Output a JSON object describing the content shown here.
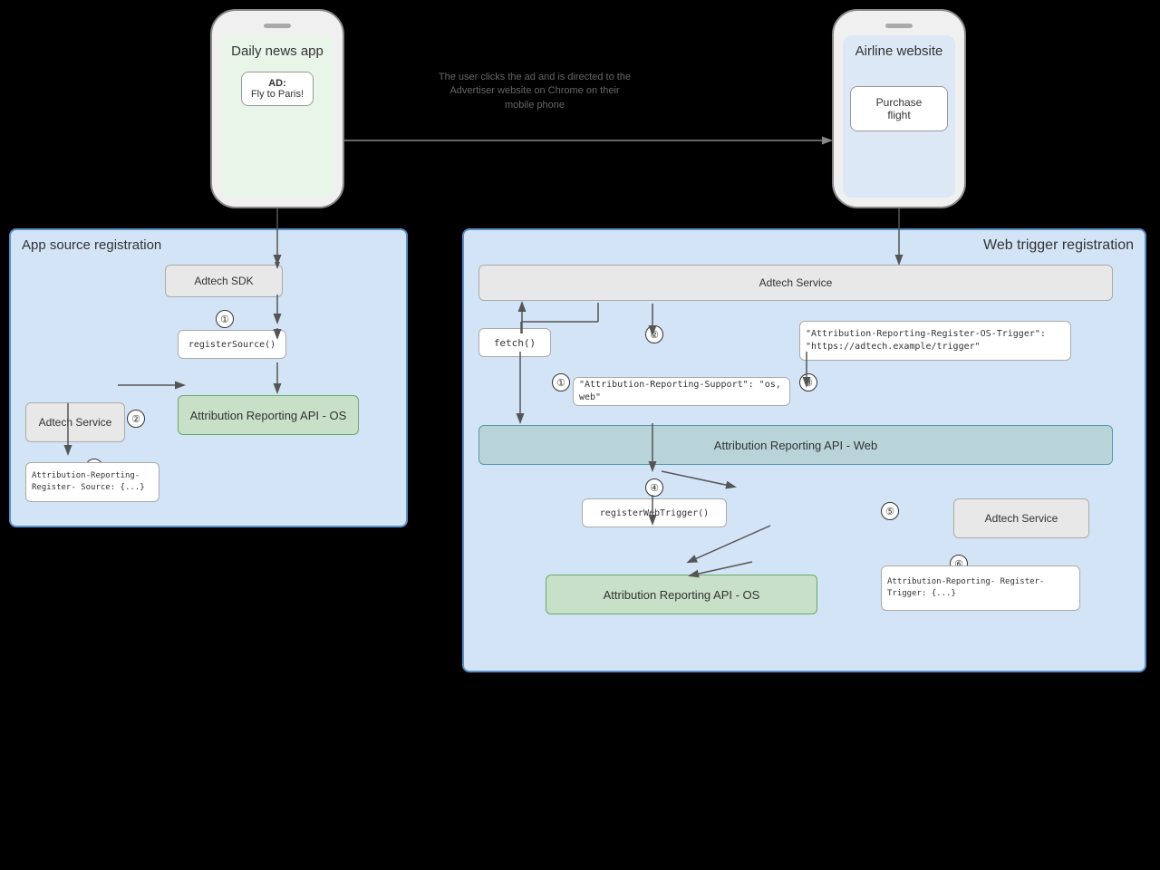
{
  "phones": {
    "left": {
      "title": "Daily news app",
      "ad_label": "AD:",
      "ad_text": "Fly to Paris!"
    },
    "right": {
      "title": "Airline website",
      "button_text": "Purchase flight"
    }
  },
  "arrow_description": "The user clicks the ad and is directed to\nthe Advertiser website on Chrome on\ntheir mobile phone",
  "panels": {
    "left": {
      "label": "App source registration"
    },
    "right": {
      "label": "Web trigger registration"
    }
  },
  "left_panel": {
    "adtech_sdk": "Adtech SDK",
    "adtech_service": "Adtech Service",
    "register_source": "registerSource()",
    "attr_api_os": "Attribution Reporting API - OS",
    "attr_register_source": "Attribution-Reporting-Register-\nSource: {...}"
  },
  "right_panel": {
    "adtech_service_top": "Adtech Service",
    "adtech_service_bottom": "Adtech Service",
    "fetch": "fetch()",
    "attr_api_web": "Attribution Reporting API - Web",
    "attr_api_os": "Attribution Reporting API - OS",
    "register_web_trigger": "registerWebTrigger()",
    "attr_support": "\"Attribution-Reporting-Support\": \"os, web\"",
    "attr_os_trigger": "\"Attribution-Reporting-Register-OS-Trigger\":\n\"https://adtech.example/trigger\"",
    "attr_register_trigger": "Attribution-Reporting-\nRegister-Trigger: {...}"
  }
}
